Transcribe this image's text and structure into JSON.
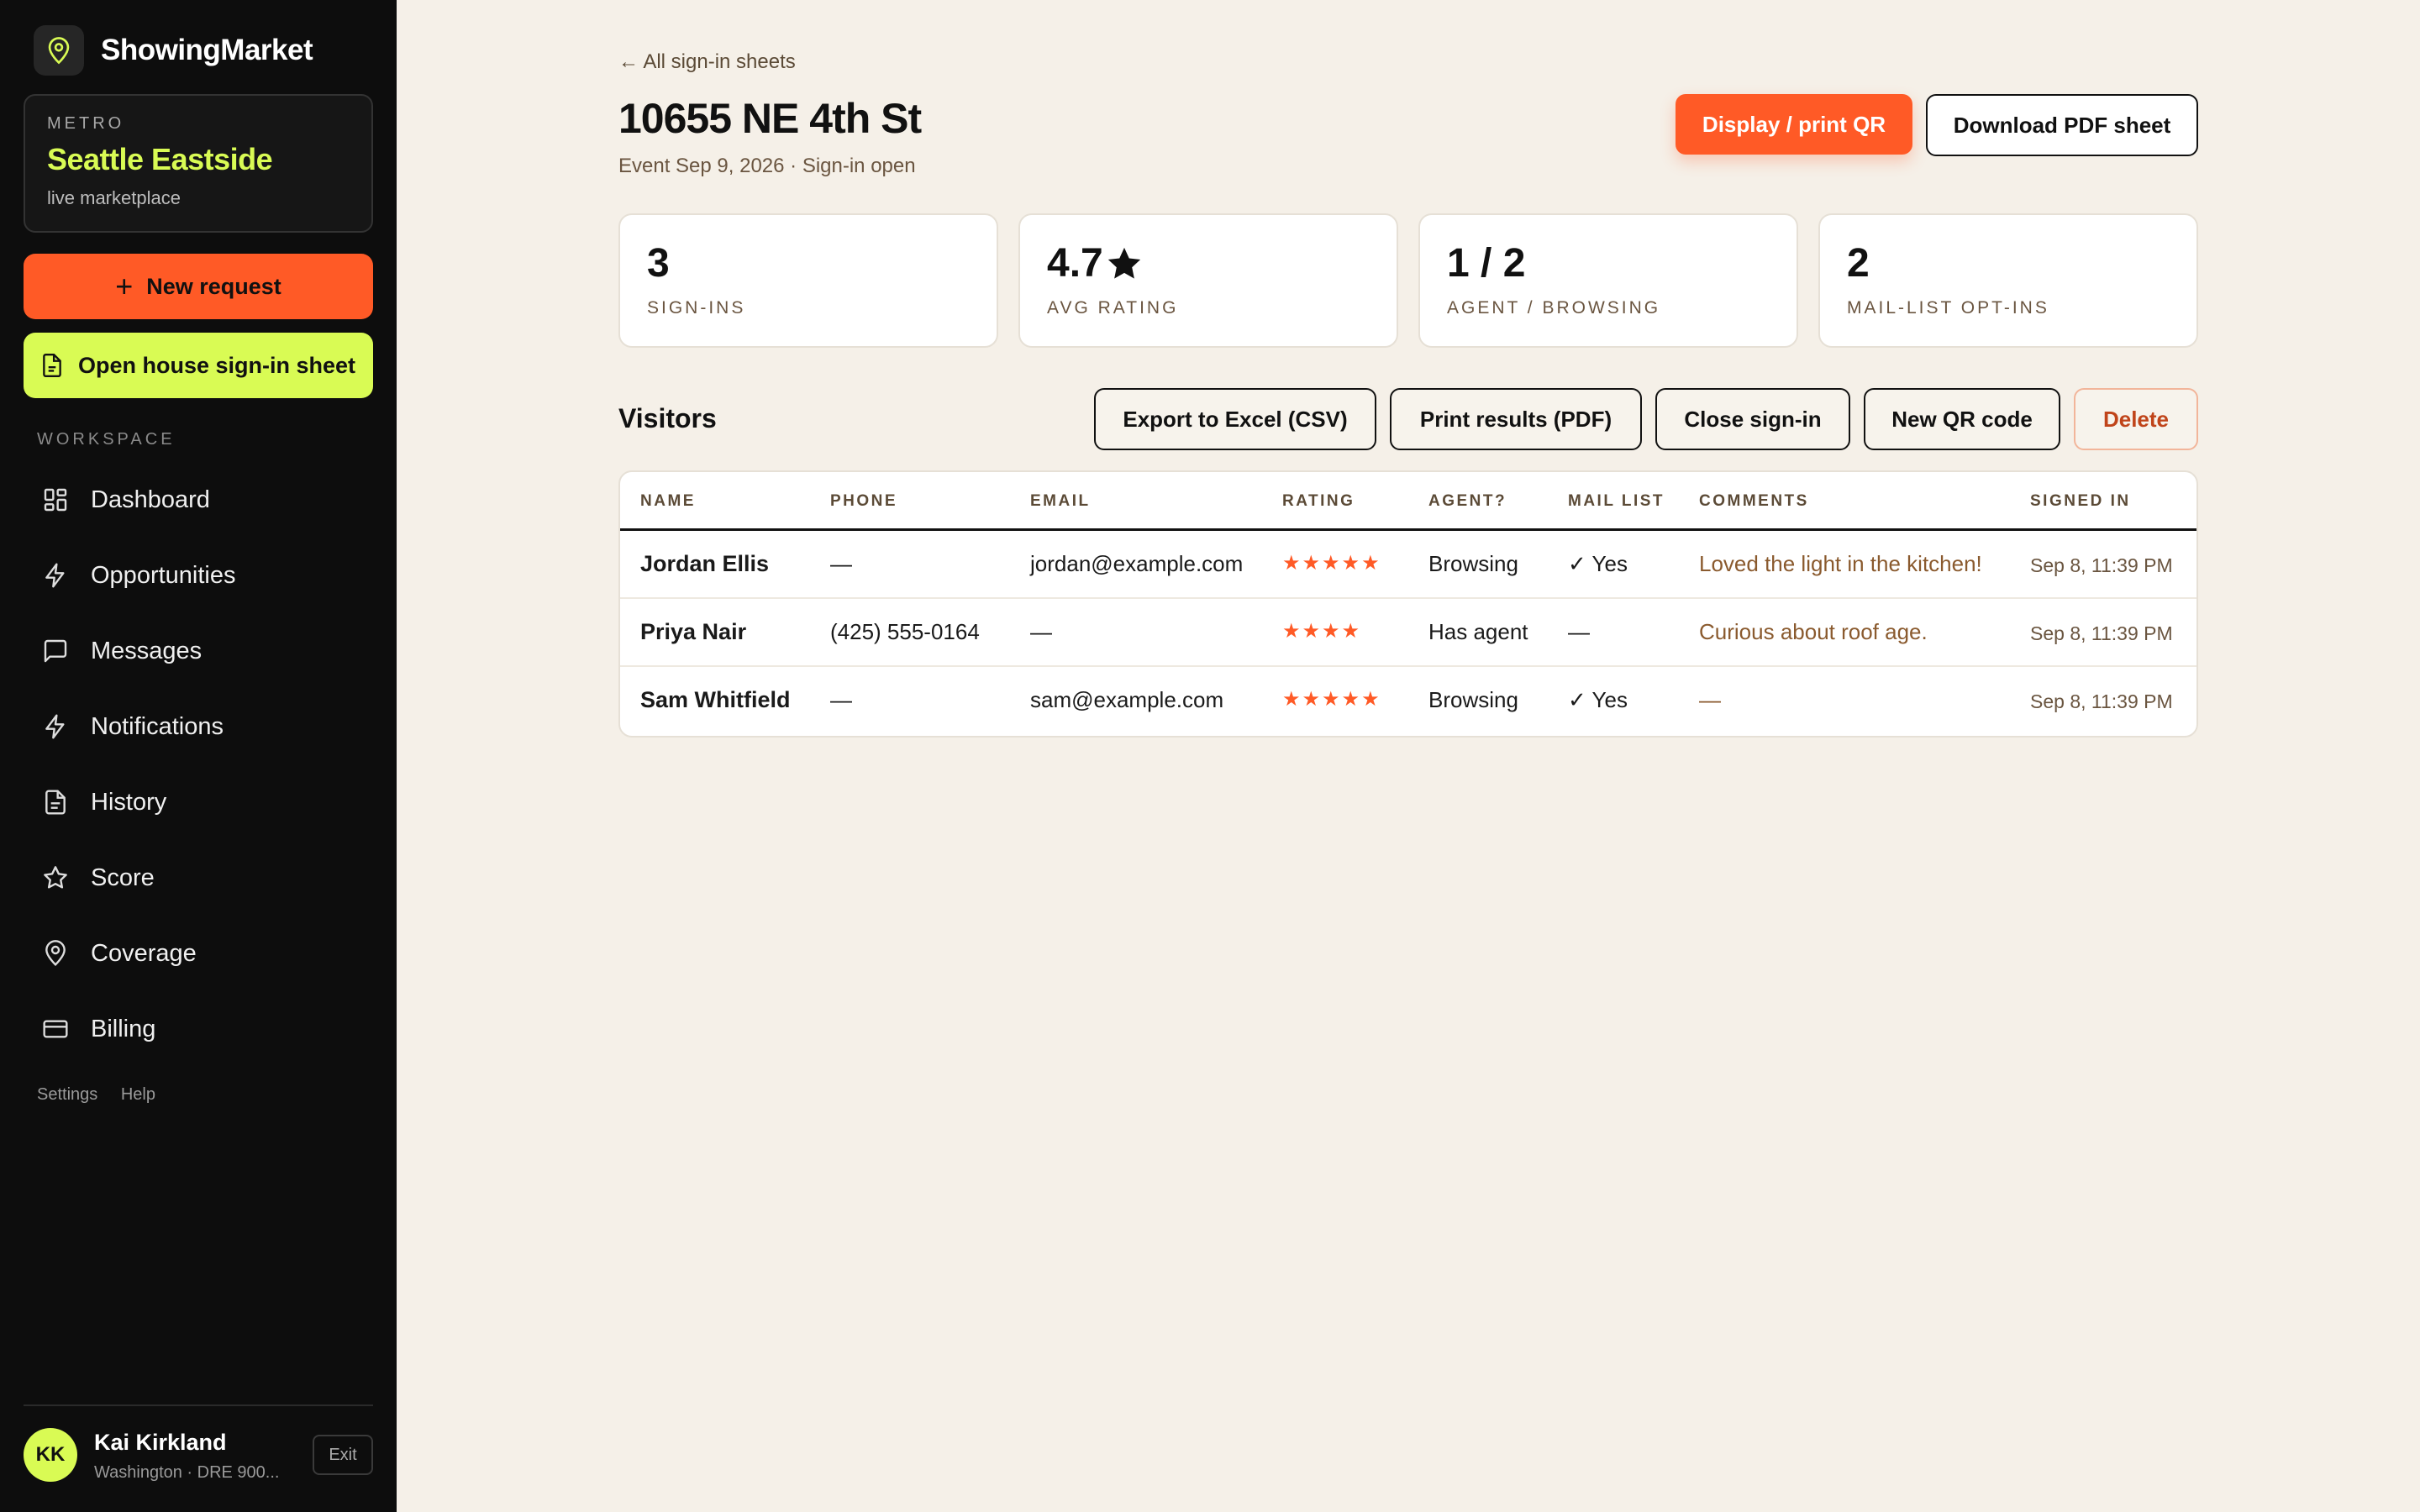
{
  "brand": {
    "name": "ShowingMarket",
    "logo_icon": "map-pin-icon",
    "accent": "#d9fb54"
  },
  "metro": {
    "label": "METRO",
    "name": "Seattle Eastside",
    "sub": "live marketplace"
  },
  "actions": {
    "new_request": "New request",
    "open_sheet": "Open house sign-in sheet"
  },
  "workspace_label": "WORKSPACE",
  "nav": [
    {
      "label": "Dashboard",
      "icon": "grid-icon"
    },
    {
      "label": "Opportunities",
      "icon": "bolt-icon"
    },
    {
      "label": "Messages",
      "icon": "chat-icon"
    },
    {
      "label": "Notifications",
      "icon": "bolt-icon"
    },
    {
      "label": "History",
      "icon": "document-icon"
    },
    {
      "label": "Score",
      "icon": "star-icon"
    },
    {
      "label": "Coverage",
      "icon": "map-pin-icon"
    },
    {
      "label": "Billing",
      "icon": "card-icon"
    }
  ],
  "side_links": {
    "settings": "Settings",
    "help": "Help"
  },
  "user": {
    "initials": "KK",
    "name": "Kai Kirkland",
    "sub": "Washington · DRE 900...",
    "exit": "Exit"
  },
  "header": {
    "back": "← All sign-in sheets",
    "title": "10655 NE 4th St",
    "subtitle": "Event Sep 9, 2026 · Sign-in open",
    "display_qr": "Display / print QR",
    "download_pdf": "Download PDF sheet"
  },
  "stats": [
    {
      "value": "3",
      "label": "SIGN-INS"
    },
    {
      "value": "4.7",
      "label": "AVG RATING",
      "icon": "star-icon"
    },
    {
      "value": "1 / 2",
      "label": "AGENT / BROWSING"
    },
    {
      "value": "2",
      "label": "MAIL-LIST OPT-INS"
    }
  ],
  "visitors": {
    "title": "Visitors",
    "export": "Export to Excel (CSV)",
    "print": "Print results (PDF)",
    "close": "Close sign-in",
    "new_qr": "New QR code",
    "delete": "Delete"
  },
  "table": {
    "columns": [
      "NAME",
      "PHONE",
      "EMAIL",
      "RATING",
      "AGENT?",
      "MAIL LIST",
      "COMMENTS",
      "SIGNED IN"
    ],
    "rows": [
      {
        "name": "Jordan Ellis",
        "phone": "—",
        "email": "jordan@example.com",
        "rating": 5,
        "stars": "★★★★★",
        "agent": "Browsing",
        "mail": "✓ Yes",
        "comment": "Loved the light in the kitchen!",
        "signed": "Sep 8, 11:39 PM"
      },
      {
        "name": "Priya Nair",
        "phone": "(425) 555-0164",
        "email": "—",
        "rating": 4,
        "stars": "★★★★",
        "agent": "Has agent",
        "mail": "—",
        "comment": "Curious about roof age.",
        "signed": "Sep 8, 11:39 PM"
      },
      {
        "name": "Sam Whitfield",
        "phone": "—",
        "email": "sam@example.com",
        "rating": 5,
        "stars": "★★★★★",
        "agent": "Browsing",
        "mail": "✓ Yes",
        "comment": "—",
        "signed": "Sep 8, 11:39 PM"
      }
    ]
  },
  "colors": {
    "orange": "#ff5a26",
    "lime": "#d9fb54",
    "sidebar": "#0d0d0d",
    "background": "#f5f0e8"
  }
}
